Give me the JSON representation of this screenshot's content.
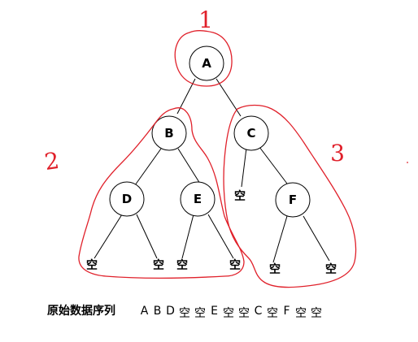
{
  "tree": {
    "nodes": [
      {
        "id": "A",
        "label": "A"
      },
      {
        "id": "B",
        "label": "B"
      },
      {
        "id": "C",
        "label": "C"
      },
      {
        "id": "D",
        "label": "D"
      },
      {
        "id": "E",
        "label": "E"
      },
      {
        "id": "F",
        "label": "F"
      }
    ],
    "null_label": "空",
    "group_numbers": [
      "1",
      "2",
      "3"
    ]
  },
  "sequence": {
    "label": "原始数据序列",
    "items": [
      "A",
      "B",
      "D",
      "空",
      "空",
      "E",
      "空",
      "空",
      "C",
      "空",
      "F",
      "空",
      "空"
    ]
  },
  "colors": {
    "annotation": "#e0202a",
    "line": "#000000",
    "node_fill": "#ffffff"
  }
}
